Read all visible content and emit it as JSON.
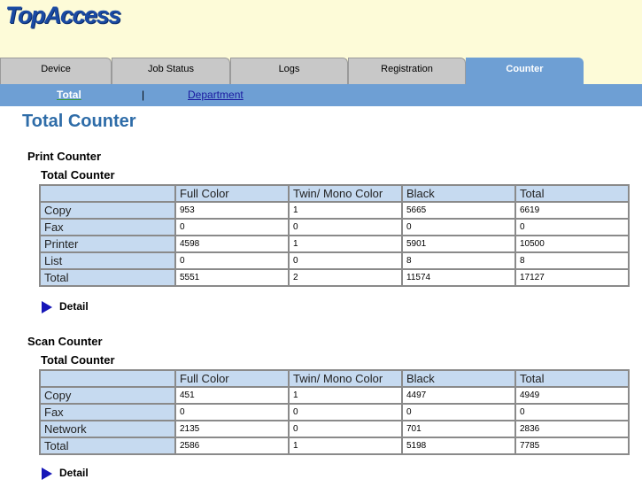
{
  "app": {
    "logo": "TopAccess"
  },
  "tabs": [
    {
      "label": "Device"
    },
    {
      "label": "Job Status"
    },
    {
      "label": "Logs"
    },
    {
      "label": "Registration"
    },
    {
      "label": "Counter",
      "active": true
    }
  ],
  "subnav": {
    "total": "Total",
    "separator": "|",
    "department": "Department"
  },
  "page_title": "Total Counter",
  "print": {
    "section_title": "Print Counter",
    "table_title": "Total Counter",
    "headers": [
      "Full Color",
      "Twin/ Mono Color",
      "Black",
      "Total"
    ],
    "rows": [
      {
        "label": "Copy",
        "values": [
          "953",
          "1",
          "5665",
          "6619"
        ]
      },
      {
        "label": "Fax",
        "values": [
          "0",
          "0",
          "0",
          "0"
        ]
      },
      {
        "label": "Printer",
        "values": [
          "4598",
          "1",
          "5901",
          "10500"
        ]
      },
      {
        "label": "List",
        "values": [
          "0",
          "0",
          "8",
          "8"
        ]
      },
      {
        "label": "Total",
        "values": [
          "5551",
          "2",
          "11574",
          "17127"
        ]
      }
    ],
    "detail": "Detail"
  },
  "scan": {
    "section_title": "Scan Counter",
    "table_title": "Total Counter",
    "headers": [
      "Full Color",
      "Twin/ Mono Color",
      "Black",
      "Total"
    ],
    "rows": [
      {
        "label": "Copy",
        "values": [
          "451",
          "1",
          "4497",
          "4949"
        ]
      },
      {
        "label": "Fax",
        "values": [
          "0",
          "0",
          "0",
          "0"
        ]
      },
      {
        "label": "Network",
        "values": [
          "2135",
          "0",
          "701",
          "2836"
        ]
      },
      {
        "label": "Total",
        "values": [
          "2586",
          "1",
          "5198",
          "7785"
        ]
      }
    ],
    "detail": "Detail"
  },
  "colors": {
    "accent": "#6e9fd4",
    "title": "#2e6ca8",
    "header_bg": "#fdfbd8",
    "cell_header": "#c6daf0",
    "logo": "#1a4aa3",
    "arrow": "#1616b8"
  }
}
